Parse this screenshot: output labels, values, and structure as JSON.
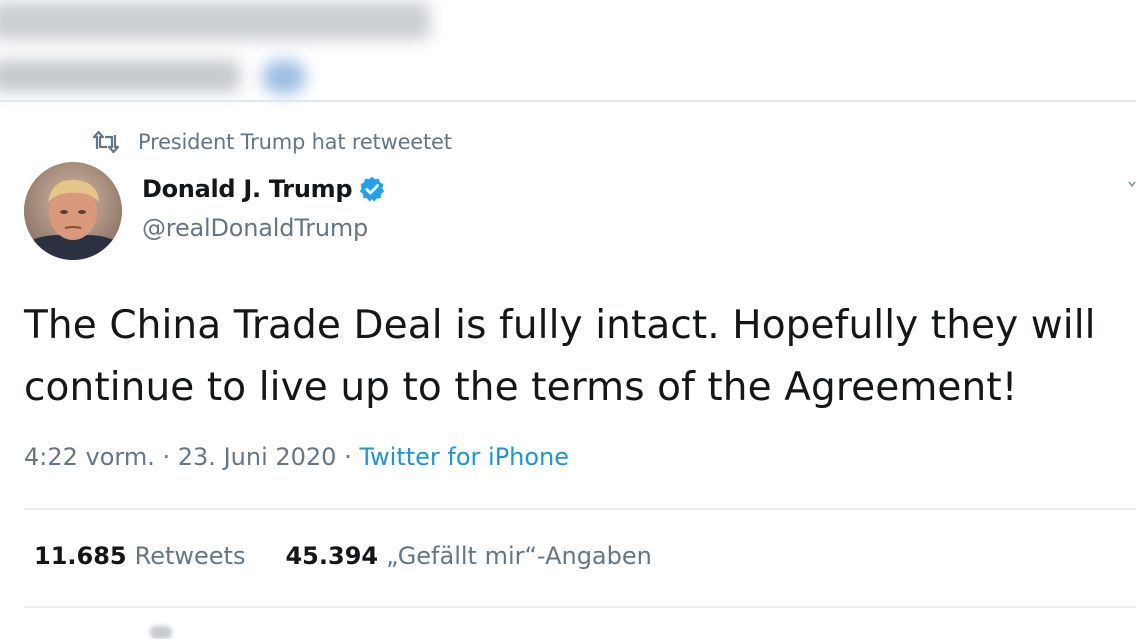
{
  "retweet_context": {
    "icon": "retweet-icon",
    "text": "President Trump hat retweetet"
  },
  "author": {
    "display_name": "Donald J. Trump",
    "handle": "@realDonaldTrump",
    "verified_icon": "verified-badge-icon",
    "verified_color": "#1da1f2"
  },
  "tweet": {
    "line1": "The China Trade Deal is fully intact. Hopefully they will",
    "line2": "continue to live up to the terms of the Agreement!"
  },
  "meta": {
    "time": "4:22 vorm.",
    "separator1": " · ",
    "date": "23. Juni 2020",
    "separator2": " · ",
    "source": "Twitter for iPhone"
  },
  "stats": {
    "retweets_count": "11.685",
    "retweets_label": "Retweets",
    "likes_count": "45.394",
    "likes_label": "„Gefällt mir“-Angaben"
  },
  "colors": {
    "accent": "#1b95e0",
    "muted_text": "#657786",
    "text": "#14171a",
    "divider": "#e6ecf0"
  }
}
